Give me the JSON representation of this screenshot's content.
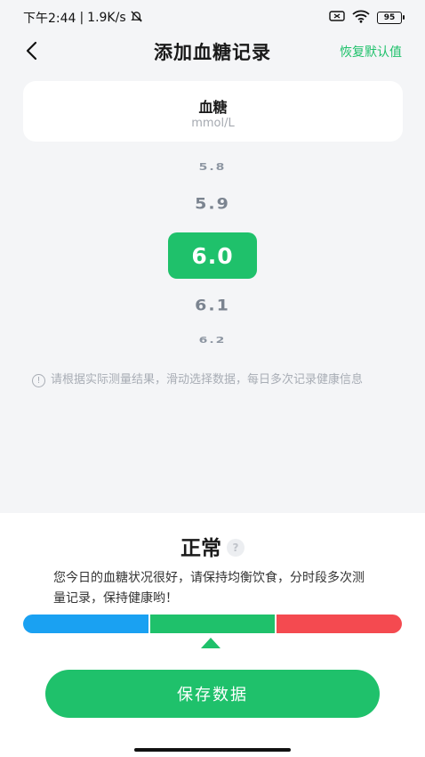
{
  "status_bar": {
    "time": "下午2:44",
    "speed": "1.9K/s",
    "battery": "95"
  },
  "nav": {
    "title": "添加血糖记录",
    "reset_label": "恢复默认值"
  },
  "metric_card": {
    "title": "血糖",
    "unit": "mmol/L"
  },
  "picker": {
    "options": [
      "5.8",
      "5.9",
      "6.0",
      "6.1",
      "6.2"
    ],
    "selected": "6.0"
  },
  "hint": "请根据实际测量结果，滑动选择数据，每日多次记录健康信息",
  "result": {
    "status": "正常",
    "description": "您今日的血糖状况很好，请保持均衡饮食，分时段多次测量记录，保持健康哟！",
    "level_segment": "normal"
  },
  "save_button_label": "保存数据",
  "colors": {
    "accent": "#1fc16b",
    "low": "#1aa1f2",
    "high": "#f44a50"
  },
  "icons": [
    "back-arrow-icon",
    "mute-bell-icon",
    "no-sim-icon",
    "wifi-icon",
    "battery-icon",
    "info-icon",
    "question-icon",
    "pointer-triangle-icon"
  ]
}
